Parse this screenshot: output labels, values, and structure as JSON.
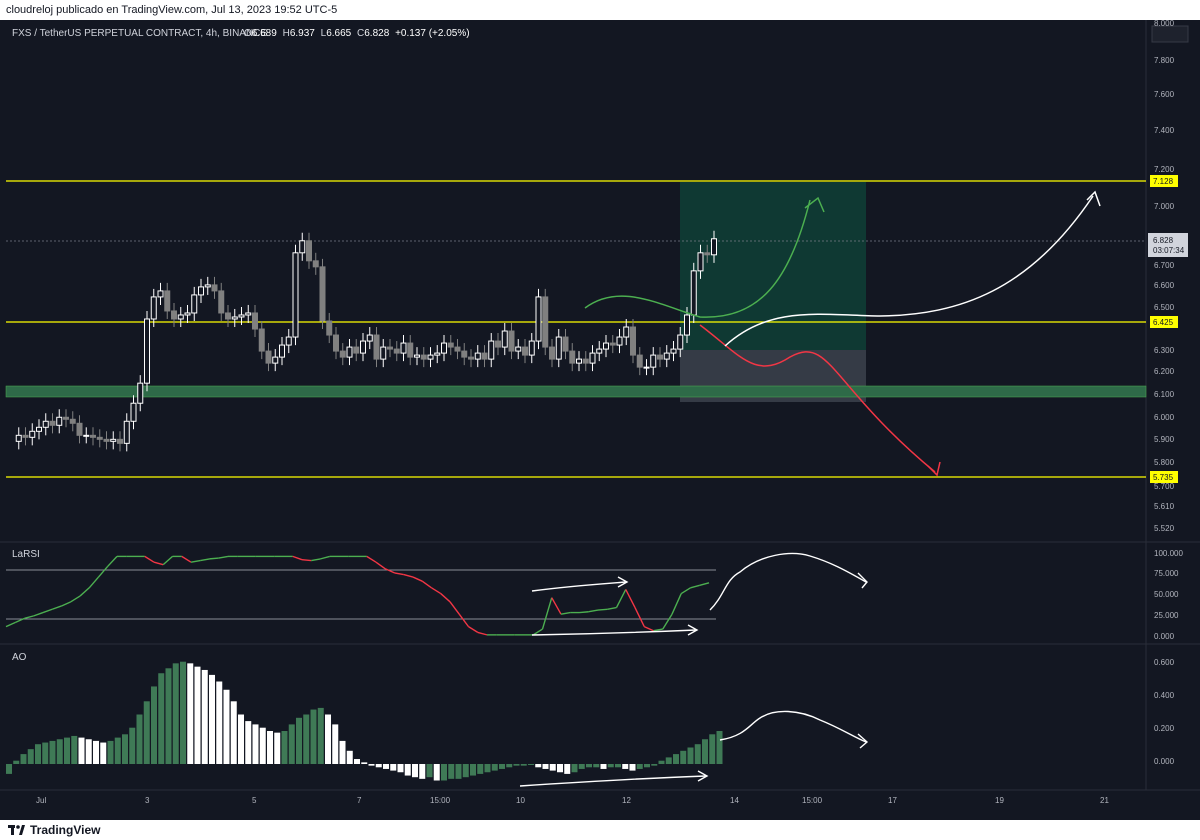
{
  "header": {
    "publish_line": "cloudreloj publicado en TradingView.com, Jul 13, 2023 19:52 UTC-5"
  },
  "legend": {
    "symbol": "FXS / TetherUS PERPETUAL CONTRACT, 4h, BINANCE",
    "o_label": "O",
    "o_value": "6.689",
    "h_label": "H",
    "h_value": "6.937",
    "l_label": "L",
    "l_value": "6.665",
    "c_label": "C",
    "c_value": "6.828",
    "change": "+0.137 (+2.05%)"
  },
  "price_scale": {
    "ticks": [
      "8.000",
      "7.800",
      "7.600",
      "7.400",
      "7.200",
      "7.000",
      "6.700",
      "6.600",
      "6.500",
      "6.300",
      "6.200",
      "6.100",
      "6.000",
      "5.900",
      "5.800",
      "5.700",
      "5.610",
      "5.520"
    ],
    "levels": [
      {
        "label": "7.128",
        "value": 7.128
      },
      {
        "label": "6.425",
        "value": 6.425
      },
      {
        "label": "5.735",
        "value": 5.735
      }
    ],
    "last_price": "6.828",
    "countdown": "03:07:34"
  },
  "indicators": {
    "rsi": {
      "name": "LaRSI",
      "ticks": [
        "100.000",
        "75.000",
        "50.000",
        "25.000",
        "0.000"
      ]
    },
    "ao": {
      "name": "AO",
      "ticks": [
        "0.600",
        "0.400",
        "0.200",
        "0.000"
      ]
    }
  },
  "time_axis": {
    "labels": [
      "Jul",
      "3",
      "5",
      "7",
      "15:00",
      "10",
      "12",
      "14",
      "15:00",
      "17",
      "19",
      "21"
    ]
  },
  "footer": {
    "brand": "TradingView"
  },
  "colors": {
    "background": "#131722",
    "up": "#ffffff",
    "down": "#808080",
    "level_line": "#ffff00",
    "support_zone": "#2e6a48",
    "target_zone": "#0f3d35",
    "stop_zone": "#3a3f4a",
    "bull_arrow": "#4caf50",
    "bear_arrow": "#f23645",
    "ao_up": "#3f7a56",
    "rsi_up": "#4caf50",
    "rsi_down": "#f23645"
  },
  "icons": {
    "logo": "tradingview-logo-icon"
  }
}
